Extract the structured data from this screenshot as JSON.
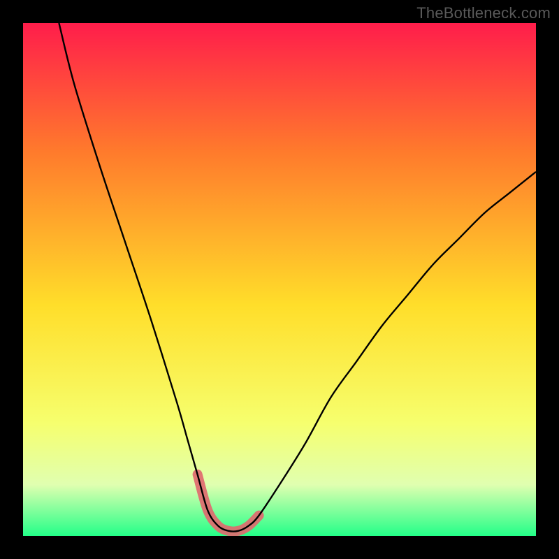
{
  "watermark": "TheBottleneck.com",
  "colors": {
    "frame": "#000000",
    "gradient_top": "#ff1d4b",
    "gradient_mid_upper": "#ff7a2c",
    "gradient_mid": "#ffde2a",
    "gradient_mid_lower": "#f6ff6e",
    "gradient_lower": "#e0ffb0",
    "gradient_bottom": "#23ff88",
    "curve": "#000000",
    "highlight": "#e06a6f"
  },
  "chart_data": {
    "type": "line",
    "title": "",
    "xlabel": "",
    "ylabel": "",
    "xlim": [
      0,
      100
    ],
    "ylim": [
      0,
      100
    ],
    "series": [
      {
        "name": "curve",
        "x": [
          7,
          10,
          15,
          20,
          25,
          30,
          32,
          34,
          36,
          38,
          40,
          42,
          44,
          46,
          50,
          55,
          60,
          65,
          70,
          75,
          80,
          85,
          90,
          95,
          100
        ],
        "y": [
          100,
          88,
          72,
          57,
          42,
          26,
          19,
          12,
          5,
          2,
          1,
          1,
          2,
          4,
          10,
          18,
          27,
          34,
          41,
          47,
          53,
          58,
          63,
          67,
          71
        ]
      }
    ],
    "highlight_segment": {
      "x_start": 33,
      "x_end": 46,
      "description": "trough region marked with thick pink rounded stroke"
    },
    "gradient_stops": [
      {
        "offset": 0.0,
        "color": "#ff1d4b"
      },
      {
        "offset": 0.25,
        "color": "#ff7a2c"
      },
      {
        "offset": 0.55,
        "color": "#ffde2a"
      },
      {
        "offset": 0.78,
        "color": "#f6ff6e"
      },
      {
        "offset": 0.9,
        "color": "#e0ffb0"
      },
      {
        "offset": 1.0,
        "color": "#23ff88"
      }
    ]
  }
}
